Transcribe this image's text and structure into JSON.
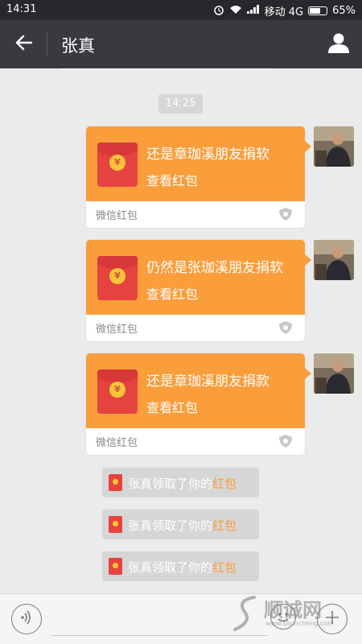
{
  "status_bar": {
    "time": "14:31",
    "carrier": "移动 4G",
    "battery": "65%"
  },
  "header": {
    "title": "张真",
    "back_icon": "arrow-left-icon",
    "profile_icon": "person-icon"
  },
  "chat": {
    "timestamp": "14:25",
    "messages": [
      {
        "type": "red-packet",
        "text": "还是章珈溪朋友捐软",
        "action": "查看红包",
        "footer": "微信红包"
      },
      {
        "type": "red-packet",
        "text": "仍然是张珈溪朋友捐软",
        "action": "查看红包",
        "footer": "微信红包"
      },
      {
        "type": "red-packet",
        "text": "还是章珈溪朋友捐款",
        "action": "查看红包",
        "footer": "微信红包"
      }
    ],
    "notices": [
      {
        "prefix": "张真领取了你的",
        "link": "红包"
      },
      {
        "prefix": "张真领取了你的",
        "link": "红包"
      },
      {
        "prefix": "张真领取了你的",
        "link": "红包"
      }
    ]
  },
  "input_bar": {
    "placeholder": "",
    "voice_icon": "voice-icon",
    "emoji_icon": "emoji-icon",
    "plus_icon": "plus-icon"
  },
  "watermark": {
    "text": "顺诚网",
    "url": "www.shuncheng.com"
  },
  "colors": {
    "title_bar": "#393a3f",
    "red_packet": "#fa9d3b",
    "envelope": "#e64340",
    "background": "#ebebeb"
  }
}
